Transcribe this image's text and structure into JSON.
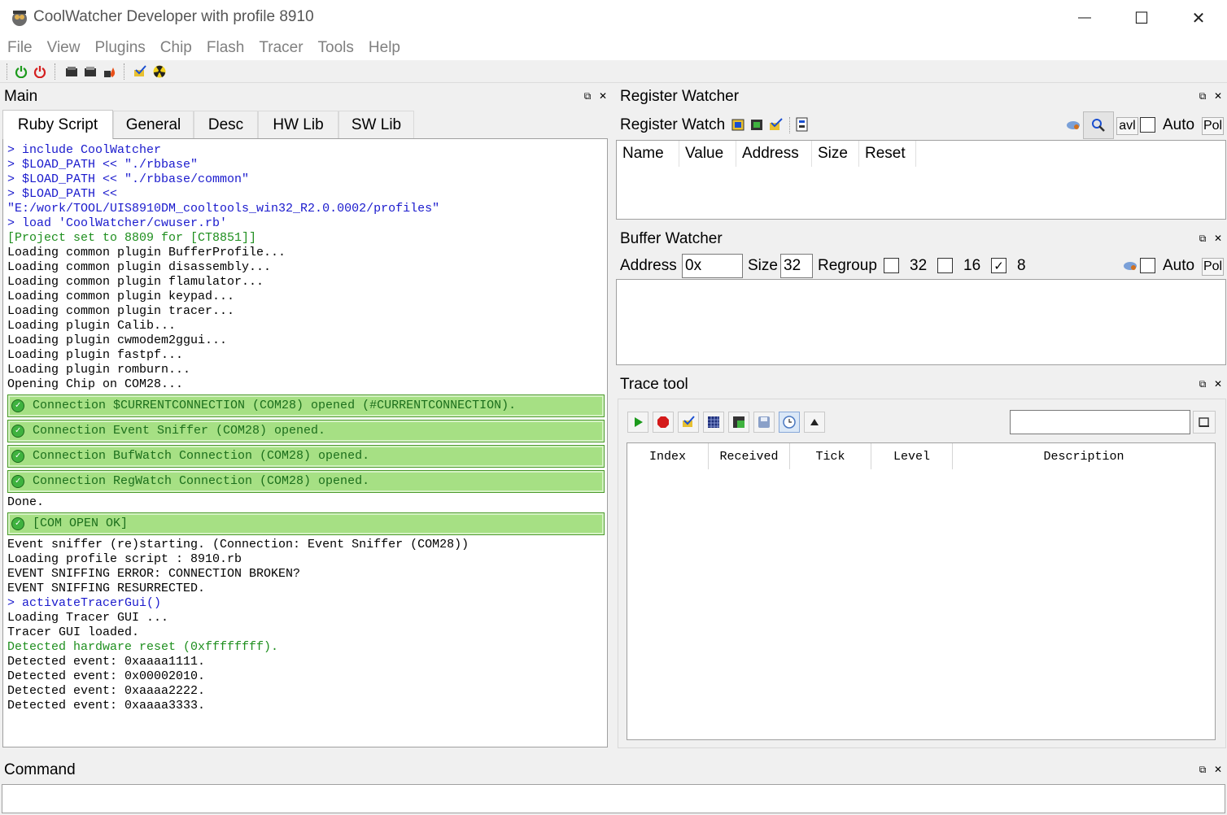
{
  "window": {
    "title": "CoolWatcher Developer with profile 8910",
    "minimize_glyph": "—",
    "maximize_glyph": "☐",
    "close_glyph": "✕"
  },
  "menu": [
    "File",
    "View",
    "Plugins",
    "Chip",
    "Flash",
    "Tracer",
    "Tools",
    "Help"
  ],
  "toolbar_icons": [
    "power-on-icon",
    "power-off-icon",
    "load-icon",
    "save-icon",
    "flame-icon",
    "chip-check-icon",
    "radiation-icon"
  ],
  "main": {
    "title": "Main",
    "tabs": [
      "Ruby Script",
      "General",
      "Desc",
      "HW Lib",
      "SW Lib"
    ],
    "active_tab": "Ruby Script",
    "console": [
      {
        "type": "cmd",
        "text": "> include CoolWatcher"
      },
      {
        "type": "cmd",
        "text": "> $LOAD_PATH << \"./rbbase\""
      },
      {
        "type": "cmd",
        "text": "> $LOAD_PATH << \"./rbbase/common\""
      },
      {
        "type": "cmd",
        "text": "> $LOAD_PATH <<"
      },
      {
        "type": "cmd",
        "text": "\"E:/work/TOOL/UIS8910DM_cooltools_win32_R2.0.0002/profiles\""
      },
      {
        "type": "cmd",
        "text": "> load 'CoolWatcher/cwuser.rb'"
      },
      {
        "type": "green",
        "text": "[Project set to 8809 for [CT8851]]"
      },
      {
        "type": "plain",
        "text": "Loading common plugin BufferProfile..."
      },
      {
        "type": "plain",
        "text": "Loading common plugin disassembly..."
      },
      {
        "type": "plain",
        "text": "Loading common plugin flamulator..."
      },
      {
        "type": "plain",
        "text": "Loading common plugin keypad..."
      },
      {
        "type": "plain",
        "text": "Loading common plugin tracer..."
      },
      {
        "type": "plain",
        "text": "Loading plugin Calib..."
      },
      {
        "type": "plain",
        "text": "Loading plugin cwmodem2ggui..."
      },
      {
        "type": "plain",
        "text": "Loading plugin fastpf..."
      },
      {
        "type": "plain",
        "text": "Loading plugin romburn..."
      },
      {
        "type": "plain",
        "text": "Opening Chip on COM28..."
      },
      {
        "type": "conn",
        "text": "Connection $CURRENTCONNECTION (COM28) opened (#CURRENTCONNECTION)."
      },
      {
        "type": "conn",
        "text": "Connection Event Sniffer (COM28) opened."
      },
      {
        "type": "conn",
        "text": "Connection BufWatch Connection (COM28) opened."
      },
      {
        "type": "conn",
        "text": "Connection RegWatch Connection (COM28) opened."
      },
      {
        "type": "plain",
        "text": "Done."
      },
      {
        "type": "conn",
        "text": "[COM OPEN OK]"
      },
      {
        "type": "plain",
        "text": "Event sniffer (re)starting. (Connection: Event Sniffer (COM28))"
      },
      {
        "type": "plain",
        "text": "Loading profile script : 8910.rb"
      },
      {
        "type": "plain",
        "text": "EVENT SNIFFING ERROR: CONNECTION BROKEN?"
      },
      {
        "type": "plain",
        "text": "EVENT SNIFFING RESURRECTED."
      },
      {
        "type": "cmd",
        "text": "> activateTracerGui()"
      },
      {
        "type": "plain",
        "text": "Loading Tracer GUI ..."
      },
      {
        "type": "plain",
        "text": "Tracer GUI loaded."
      },
      {
        "type": "green",
        "text": "Detected hardware reset (0xffffffff)."
      },
      {
        "type": "plain",
        "text": "Detected event: 0xaaaa1111."
      },
      {
        "type": "plain",
        "text": "Detected event: 0x00002010."
      },
      {
        "type": "plain",
        "text": "Detected event: 0xaaaa2222."
      },
      {
        "type": "plain",
        "text": "Detected event: 0xaaaa3333."
      }
    ]
  },
  "register_watcher": {
    "title": "Register Watcher",
    "toolbar_label": "Register Watch",
    "auto_label": "Auto",
    "avl_label": "avl",
    "pol_label": "Pol",
    "columns": [
      "Name",
      "Value",
      "Address",
      "Size",
      "Reset"
    ]
  },
  "buffer_watcher": {
    "title": "Buffer Watcher",
    "address_label": "Address",
    "address_value": "0x",
    "size_label": "Size",
    "size_value": "32",
    "regroup_label": "Regroup",
    "regroup_options": [
      {
        "label": "32",
        "checked": false
      },
      {
        "label": "16",
        "checked": false
      },
      {
        "label": "8",
        "checked": true
      }
    ],
    "auto_label": "Auto",
    "pol_label": "Pol"
  },
  "trace_tool": {
    "title": "Trace tool",
    "search_value": "",
    "columns": [
      "Index",
      "Received",
      "Tick",
      "Level",
      "Description"
    ]
  },
  "command": {
    "title": "Command",
    "input_value": ""
  },
  "dock_controls": {
    "float_glyph": "⧉",
    "close_glyph": "✕"
  },
  "colors": {
    "console_cmd": "#1a1acd",
    "console_green": "#1f8f1f",
    "connection_bg": "#a6e084"
  }
}
